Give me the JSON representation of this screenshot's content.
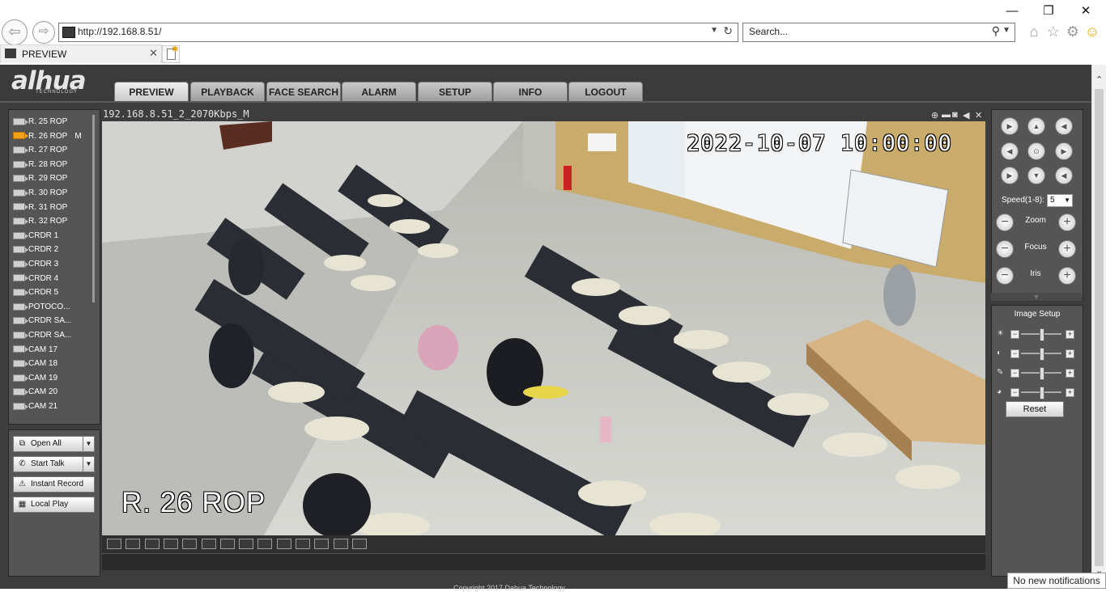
{
  "browser": {
    "url": "http://192.168.8.51/",
    "search_placeholder": "Search...",
    "tab_title": "PREVIEW",
    "notification": "No new notifications"
  },
  "app": {
    "logo": "alhua",
    "logo_sub": "TECHNOLOGY",
    "nav": [
      "PREVIEW",
      "PLAYBACK",
      "FACE SEARCH",
      "ALARM",
      "SETUP",
      "INFO",
      "LOGOUT"
    ],
    "active_nav": "PREVIEW"
  },
  "devices": [
    {
      "label": "R. 25 ROP"
    },
    {
      "label": "R. 26 ROP",
      "active": true,
      "flag": "M"
    },
    {
      "label": "R. 27 ROP"
    },
    {
      "label": "R. 28 ROP"
    },
    {
      "label": "R. 29 ROP"
    },
    {
      "label": "R. 30 ROP"
    },
    {
      "label": "R. 31 ROP"
    },
    {
      "label": "R. 32 ROP"
    },
    {
      "label": "CRDR 1"
    },
    {
      "label": "CRDR 2"
    },
    {
      "label": "CRDR 3"
    },
    {
      "label": "CRDR 4"
    },
    {
      "label": "CRDR 5"
    },
    {
      "label": "POTOCO..."
    },
    {
      "label": "CRDR SA..."
    },
    {
      "label": "CRDR SA..."
    },
    {
      "label": "CAM 17"
    },
    {
      "label": "CAM 18"
    },
    {
      "label": "CAM 19"
    },
    {
      "label": "CAM 20"
    },
    {
      "label": "CAM 21"
    }
  ],
  "controls": {
    "open_all": "Open All",
    "start_talk": "Start Talk",
    "instant_record": "Instant Record",
    "local_play": "Local Play"
  },
  "video": {
    "stream_title": "192.168.8.51_2_2070Kbps_M",
    "timestamp": "2022-10-07 10:00:00",
    "camera_label": "R. 26 ROP",
    "split_buttons": [
      "1x1",
      "2x2",
      "fit",
      "full",
      "1",
      "4",
      "6",
      "8",
      "9",
      "12",
      "16",
      "20",
      "25",
      "36"
    ]
  },
  "ptz": {
    "speed_label": "Speed(1-8):",
    "speed_value": "5",
    "zoom": "Zoom",
    "focus": "Focus",
    "iris": "Iris"
  },
  "image_setup": {
    "title": "Image Setup",
    "reset": "Reset",
    "sliders": [
      {
        "name": "brightness-icon",
        "glyph": "☀",
        "value": 0.5
      },
      {
        "name": "contrast-icon",
        "glyph": "◐",
        "value": 0.5
      },
      {
        "name": "saturation-icon",
        "glyph": "✎",
        "value": 0.5
      },
      {
        "name": "hue-icon",
        "glyph": "◕",
        "value": 0.5
      }
    ]
  },
  "footer": "Copyright 2017 Dahua Technology"
}
